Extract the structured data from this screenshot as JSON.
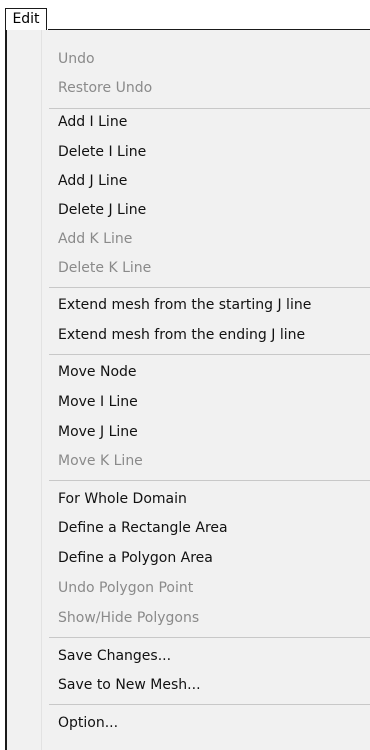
{
  "menubar": {
    "title": "Edit"
  },
  "menu": {
    "undo": "Undo",
    "restore_undo": "Restore Undo",
    "add_i_line": "Add I Line",
    "delete_i_line": "Delete I Line",
    "add_j_line": "Add J Line",
    "delete_j_line": "Delete J Line",
    "add_k_line": "Add K Line",
    "delete_k_line": "Delete K Line",
    "extend_start": "Extend mesh from the starting J line",
    "extend_end": "Extend mesh from the ending J line",
    "move_node": "Move Node",
    "move_i_line": "Move I Line",
    "move_j_line": "Move J Line",
    "move_k_line": "Move K Line",
    "whole_domain": "For Whole Domain",
    "rect_area": "Define a Rectangle Area",
    "polygon_area": "Define a Polygon Area",
    "undo_polygon_point": "Undo Polygon Point",
    "show_hide_polygons": "Show/Hide Polygons",
    "save_changes": "Save Changes...",
    "save_new_mesh": "Save to New Mesh...",
    "option": "Option..."
  },
  "colors": {
    "enabled_text": "#111111",
    "disabled_text": "#8a8a8a",
    "menu_background": "#f1f1f1"
  }
}
